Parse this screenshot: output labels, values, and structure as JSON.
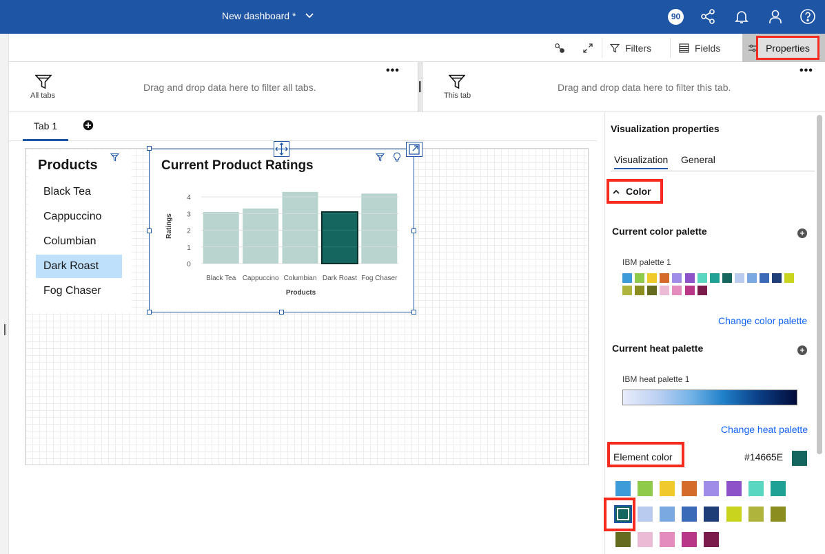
{
  "header": {
    "title": "New dashboard *",
    "notification_count": "90",
    "bg_color": "#1f55a5"
  },
  "toolbar": {
    "filters_label": "Filters",
    "fields_label": "Fields",
    "properties_label": "Properties"
  },
  "filter_zones": {
    "all_tabs": {
      "label": "All tabs",
      "hint": "Drag and drop data here to filter all tabs."
    },
    "this_tab": {
      "label": "This tab",
      "hint": "Drag and drop data here to filter this tab."
    },
    "more_label": "•••"
  },
  "tabs": [
    {
      "label": "Tab 1",
      "active": true
    }
  ],
  "product_list": {
    "title": "Products",
    "items": [
      {
        "label": "Black Tea",
        "selected": false
      },
      {
        "label": "Cappuccino",
        "selected": false
      },
      {
        "label": "Columbian",
        "selected": false
      },
      {
        "label": "Dark Roast",
        "selected": true
      },
      {
        "label": "Fog Chaser",
        "selected": false
      }
    ]
  },
  "chart_data": {
    "type": "bar",
    "title": "Current Product Ratings",
    "xlabel": "Products",
    "ylabel": "Ratings",
    "categories": [
      "Black Tea",
      "Cappuccino",
      "Columbian",
      "Dark Roast",
      "Fog Chaser"
    ],
    "values": [
      3.1,
      3.3,
      4.3,
      3.1,
      4.2
    ],
    "highlighted": "Dark Roast",
    "y_ticks": [
      "0",
      "1",
      "2",
      "3",
      "4"
    ],
    "ylim": [
      0,
      4.5
    ],
    "colors": {
      "highlight": "#14665e",
      "dimmed": "#b9d3cf",
      "grid": "#e0e0e0"
    }
  },
  "properties_panel": {
    "title": "Visualization properties",
    "tabs": [
      {
        "label": "Visualization",
        "active": true
      },
      {
        "label": "General",
        "active": false
      }
    ],
    "color_section": {
      "title": "Color",
      "current_color_palette": {
        "title": "Current color palette",
        "palette_name": "IBM palette 1",
        "swatches": [
          "#3d9bd9",
          "#8fca4a",
          "#f0c92d",
          "#d56b2a",
          "#9f8be8",
          "#8d52c7",
          "#5ad7c1",
          "#1fa196",
          "#14665e",
          "#b9cbef",
          "#7aa8e0",
          "#3b6bb8",
          "#1f3e78",
          "#c9d41e",
          "#aeb43c",
          "#8b8e1e",
          "#646b1e",
          "#ebbad5",
          "#e58cbf",
          "#b93787",
          "#7a1b4c"
        ],
        "change_link": "Change color palette"
      },
      "current_heat_palette": {
        "title": "Current heat palette",
        "palette_name": "IBM heat palette 1",
        "change_link": "Change heat palette"
      },
      "element_color": {
        "label": "Element color",
        "value": "#14665E",
        "swatch": "#14665e",
        "options": [
          "#3d9bd9",
          "#8fca4a",
          "#f0c92d",
          "#d56b2a",
          "#9f8be8",
          "#8d52c7",
          "#5ad7c1",
          "#1fa196",
          "#14665e",
          "#b9cbef",
          "#7aa8e0",
          "#3b6bb8",
          "#1f3e78",
          "#c9d41e",
          "#aeb43c",
          "#8b8e1e",
          "#646b1e",
          "#ebbad5",
          "#e58cbf",
          "#b93787",
          "#7a1b4c"
        ],
        "selected_index": 8
      }
    }
  }
}
